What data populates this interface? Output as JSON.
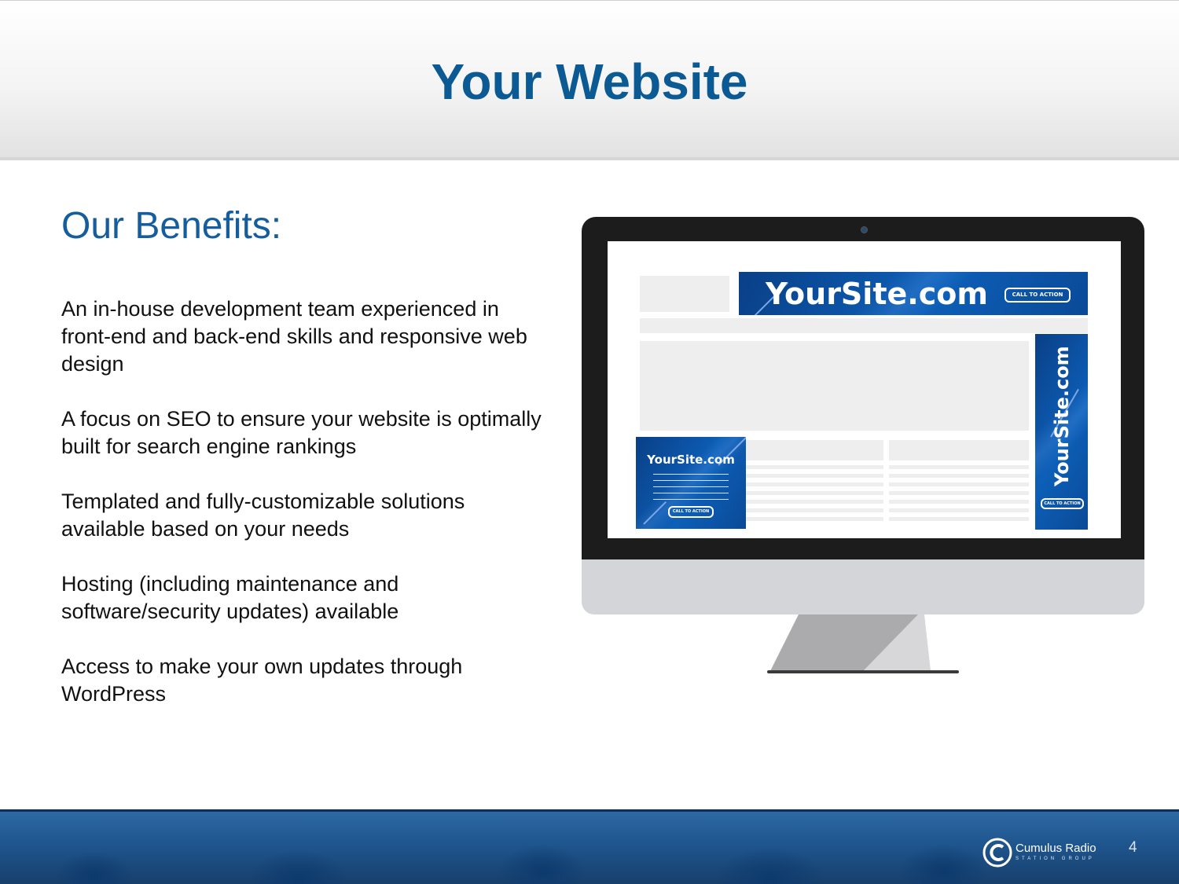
{
  "slide": {
    "title": "Your Website",
    "subheading": "Our Benefits:",
    "benefits": [
      "An in-house development team experienced in front-end and back-end skills and responsive web design",
      "A focus on SEO to ensure your website is optimally built for search engine rankings",
      "Templated and fully-customizable solutions available based on your needs",
      "Hosting (including maintenance and software/security updates) available",
      "Access to make your own updates through WordPress"
    ]
  },
  "mockup": {
    "banner_text": "YourSite.com",
    "banner_cta": "CALL TO ACTION",
    "square_text": "YourSite.com",
    "square_cta": "CALL TO ACTION",
    "skyscraper_text": "YourSite.com",
    "skyscraper_cta": "CALL TO ACTION"
  },
  "footer": {
    "logo_name": "Cumulus Radio",
    "logo_sub": "STATION GROUP",
    "page_number": "4"
  },
  "colors": {
    "title": "#0b5a93",
    "ad_blue": "#0d5fb8",
    "footer_blue": "#1f568f"
  }
}
